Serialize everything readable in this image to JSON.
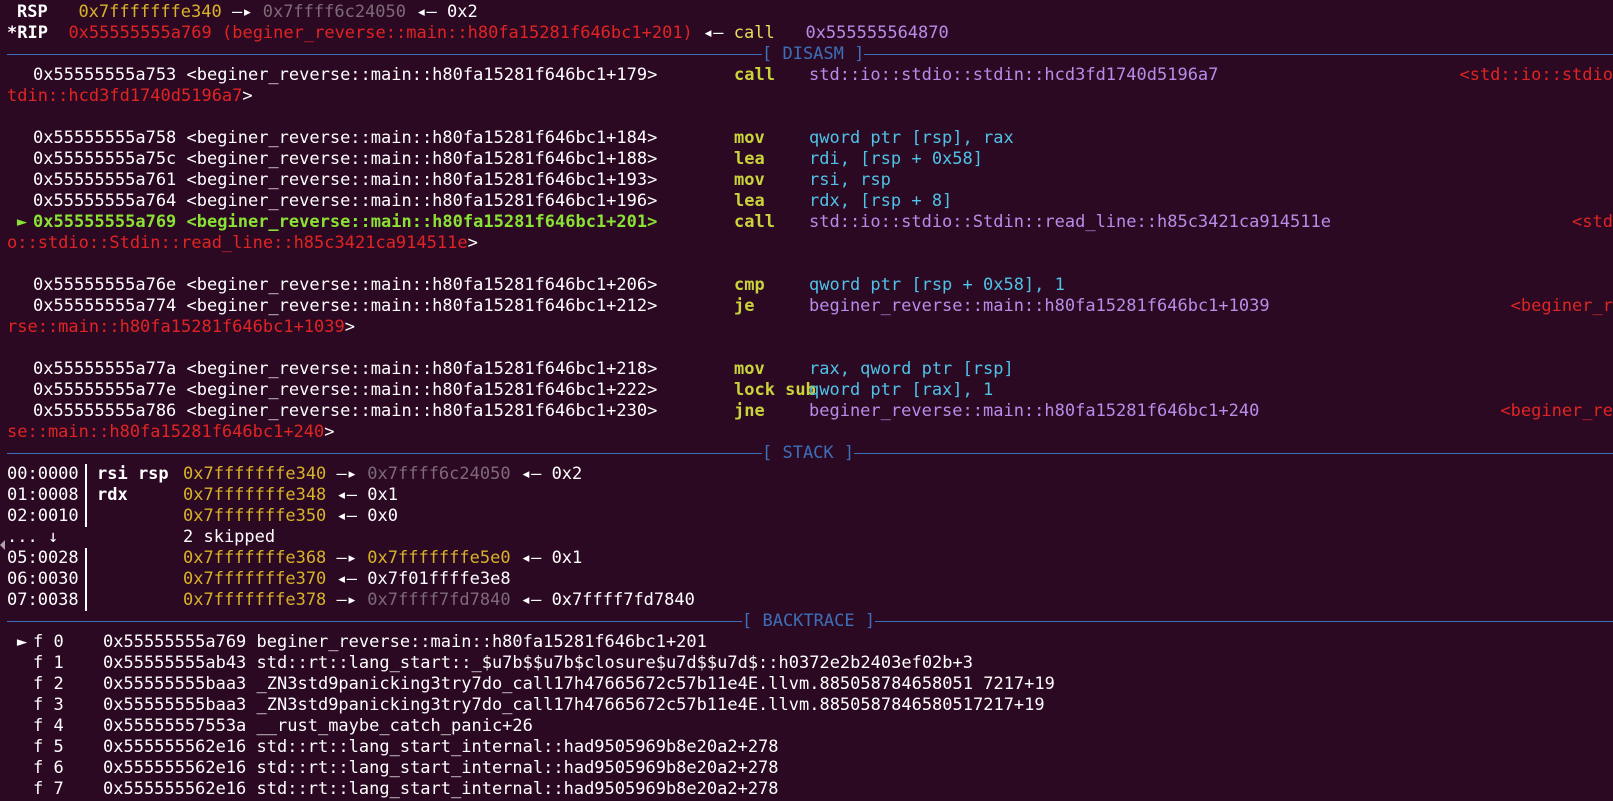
{
  "registers": {
    "rsp": {
      "name": "RSP",
      "addr": "0x7fffffffe340",
      "arrow1": "—▸",
      "ptr": "0x7ffff6c24050",
      "arrow2": "◂—",
      "val": "0x2"
    },
    "rip": {
      "name": "*RIP",
      "addr": "0x55555555a769",
      "sym": "(beginer_reverse::main::h80fa15281f646bc1+201)",
      "arrow": "◂—",
      "mnem": "call",
      "target": "0x555555564870"
    }
  },
  "disasm": {
    "title": "[ DISASM ]",
    "lines": [
      {
        "marker": " ",
        "addr": "0x55555555a753",
        "sym": "<beginer_reverse::main::h80fa15281f646bc1+179>",
        "mnem": "call",
        "op": "std::io::stdio::stdin::hcd3fd1740d5196a7",
        "hint": "<std::io::stdio",
        "wrap": "tdin::hcd3fd1740d5196a7",
        "wrap_end": ">"
      },
      {
        "marker": " ",
        "addr": "0x55555555a758",
        "sym": "<beginer_reverse::main::h80fa15281f646bc1+184>",
        "mnem": "mov",
        "op": "qword ptr [rsp], rax"
      },
      {
        "marker": " ",
        "addr": "0x55555555a75c",
        "sym": "<beginer_reverse::main::h80fa15281f646bc1+188>",
        "mnem": "lea",
        "op": "rdi, [rsp + 0x58]"
      },
      {
        "marker": " ",
        "addr": "0x55555555a761",
        "sym": "<beginer_reverse::main::h80fa15281f646bc1+193>",
        "mnem": "mov",
        "op": "rsi, rsp"
      },
      {
        "marker": " ",
        "addr": "0x55555555a764",
        "sym": "<beginer_reverse::main::h80fa15281f646bc1+196>",
        "mnem": "lea",
        "op": "rdx, [rsp + 8]"
      },
      {
        "marker": "►",
        "addr": "0x55555555a769",
        "sym": "<beginer_reverse::main::h80fa15281f646bc1+201>",
        "mnem": "call",
        "op": "std::io::stdio::Stdin::read_line::h85c3421ca914511e",
        "hint": "<std",
        "wrap": "o::stdio::Stdin::read_line::h85c3421ca914511e",
        "wrap_end": ">"
      },
      {
        "marker": " ",
        "addr": "0x55555555a76e",
        "sym": "<beginer_reverse::main::h80fa15281f646bc1+206>",
        "mnem": "cmp",
        "op": "qword ptr [rsp + 0x58], 1"
      },
      {
        "marker": " ",
        "addr": "0x55555555a774",
        "sym": "<beginer_reverse::main::h80fa15281f646bc1+212>",
        "mnem": "je",
        "op": "beginer_reverse::main::h80fa15281f646bc1+1039",
        "hint": "<beginer_r",
        "wrap": "rse::main::h80fa15281f646bc1+1039",
        "wrap_end": ">"
      },
      {
        "marker": " ",
        "addr": "0x55555555a77a",
        "sym": "<beginer_reverse::main::h80fa15281f646bc1+218>",
        "mnem": "mov",
        "op": "rax, qword ptr [rsp]"
      },
      {
        "marker": " ",
        "addr": "0x55555555a77e",
        "sym": "<beginer_reverse::main::h80fa15281f646bc1+222>",
        "mnem": "lock sub",
        "op": "qword ptr [rax], 1"
      },
      {
        "marker": " ",
        "addr": "0x55555555a786",
        "sym": "<beginer_reverse::main::h80fa15281f646bc1+230>",
        "mnem": "jne",
        "op": "beginer_reverse::main::h80fa15281f646bc1+240",
        "hint": "<beginer_re",
        "wrap": "se::main::h80fa15281f646bc1+240",
        "wrap_end": ">"
      }
    ]
  },
  "stack": {
    "title": "[ STACK ]",
    "rows": [
      {
        "off": "00:0000",
        "regs": "rsi rsp",
        "addr": "0x7fffffffe340",
        "a1": "—▸",
        "p1": "0x7ffff6c24050",
        "a2": "◂—",
        "v": "0x2"
      },
      {
        "off": "01:0008",
        "regs": "rdx",
        "addr": "0x7fffffffe348",
        "a1": "◂—",
        "p1": "0x1"
      },
      {
        "off": "02:0010",
        "regs": "",
        "addr": "0x7fffffffe350",
        "a1": "◂—",
        "p1": "0x0"
      },
      {
        "off": "... ↓",
        "regs": "",
        "skipped": "2 skipped"
      },
      {
        "off": "05:0028",
        "regs": "",
        "addr": "0x7fffffffe368",
        "a1": "—▸",
        "p1": "0x7fffffffe5e0",
        "a2": "◂—",
        "v": "0x1"
      },
      {
        "off": "06:0030",
        "regs": "",
        "addr": "0x7fffffffe370",
        "a1": "◂—",
        "p1": "0x7f01ffffe3e8"
      },
      {
        "off": "07:0038",
        "regs": "",
        "addr": "0x7fffffffe378",
        "a1": "—▸",
        "p1": "0x7ffff7fd7840",
        "a2": "◂—",
        "v": "0x7ffff7fd7840"
      }
    ]
  },
  "backtrace": {
    "title": "[ BACKTRACE ]",
    "frames": [
      {
        "marker": "►",
        "f": "f 0",
        "addr": "0x55555555a769",
        "sym": "beginer_reverse::main::h80fa15281f646bc1+201"
      },
      {
        "marker": " ",
        "f": "f 1",
        "addr": "0x55555555ab43",
        "sym": "std::rt::lang_start::_$u7b$$u7b$closure$u7d$$u7d$::h0372e2b2403ef02b+3"
      },
      {
        "marker": " ",
        "f": "f 2",
        "addr": "0x55555555baa3",
        "sym": "_ZN3std9panicking3try7do_call17h47665672c57b11e4E.llvm.885058784658051 7217+19"
      },
      {
        "marker": " ",
        "f": "f 3",
        "addr": "0x55555555baa3",
        "sym": "_ZN3std9panicking3try7do_call17h47665672c57b11e4E.llvm.8850587846580517217+19"
      },
      {
        "marker": " ",
        "f": "f 4",
        "addr": "0x55555557553a",
        "sym": "__rust_maybe_catch_panic+26"
      },
      {
        "marker": " ",
        "f": "f 5",
        "addr": "0x555555562e16",
        "sym": "std::rt::lang_start_internal::had9505969b8e20a2+278"
      },
      {
        "marker": " ",
        "f": "f 6",
        "addr": "0x555555562e16",
        "sym": "std::rt::lang_start_internal::had9505969b8e20a2+278"
      },
      {
        "marker": " ",
        "f": "f 7",
        "addr": "0x555555562e16",
        "sym": "std::rt::lang_start_internal::had9505969b8e20a2+278"
      }
    ]
  }
}
